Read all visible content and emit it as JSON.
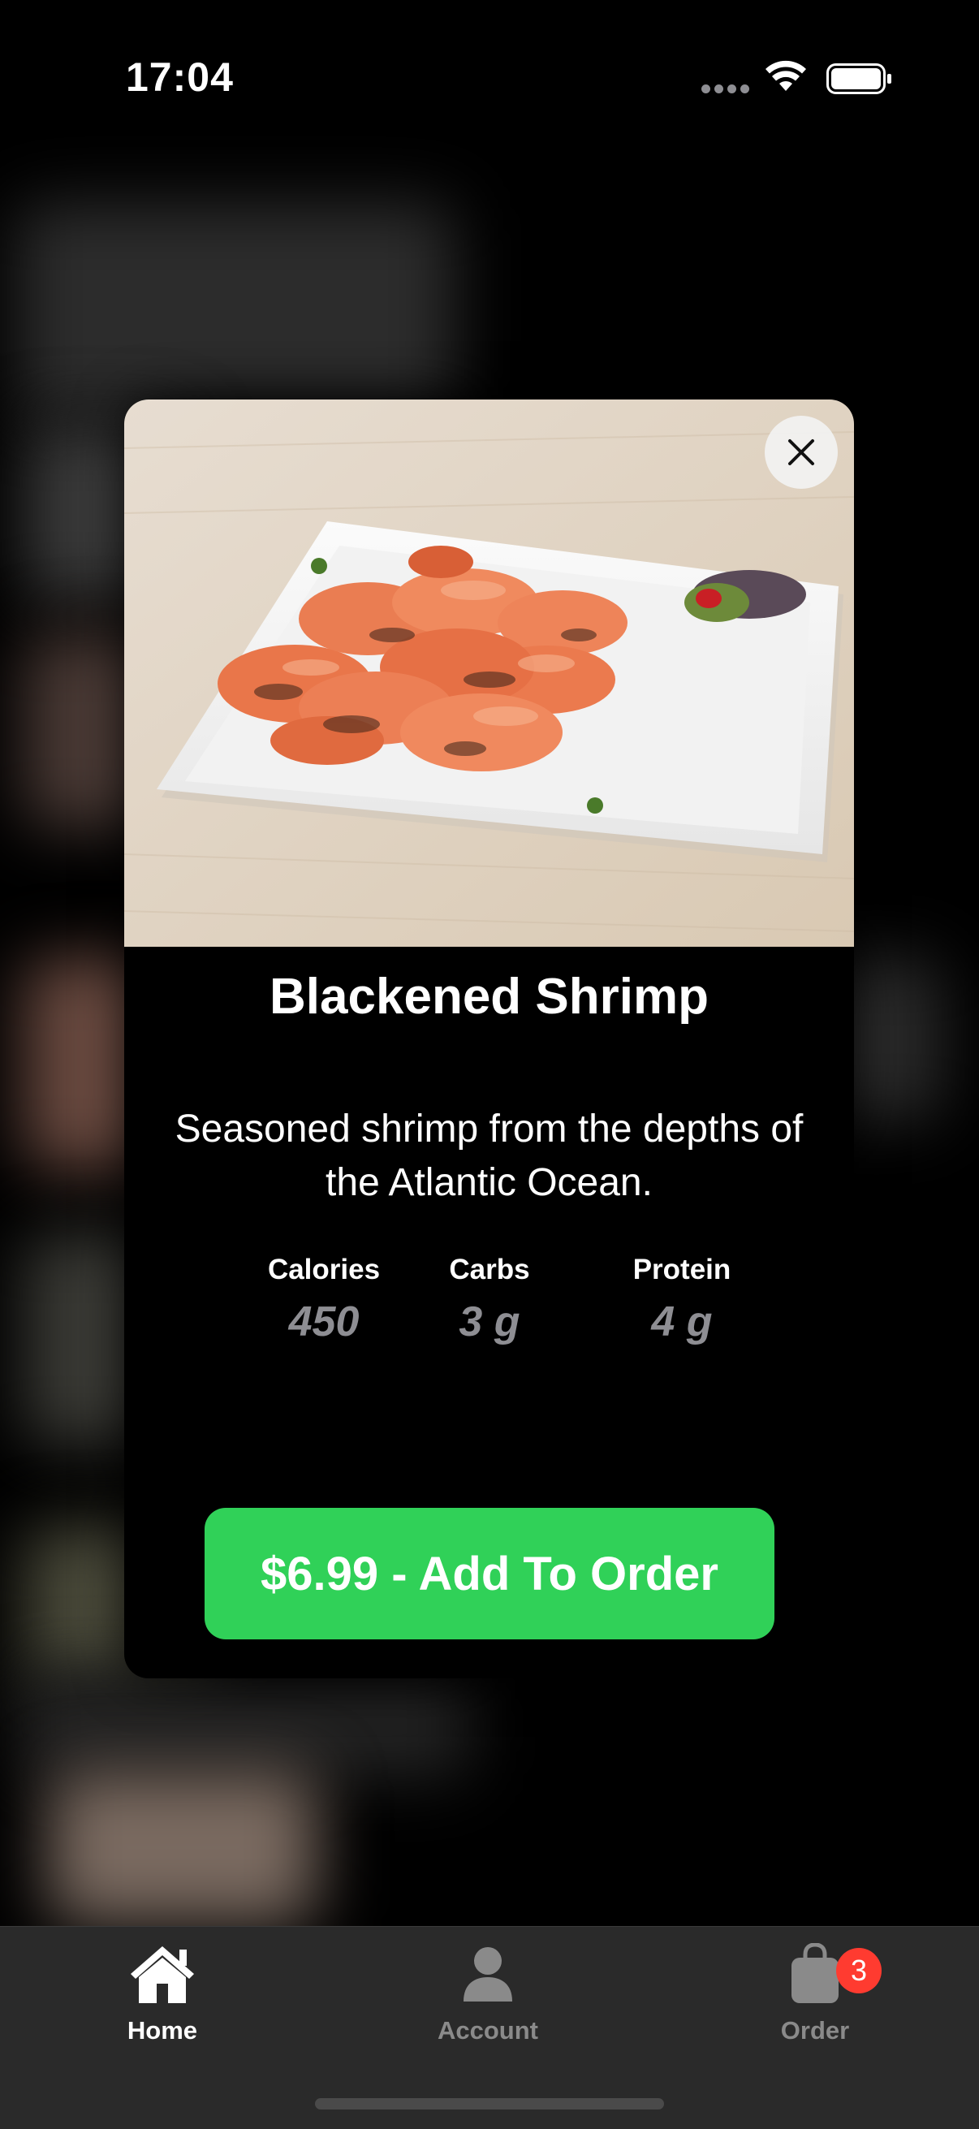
{
  "status_bar": {
    "time": "17:04"
  },
  "item": {
    "title": "Blackened Shrimp",
    "description": "Seasoned shrimp from the depths of the Atlantic Ocean.",
    "nutrition": [
      {
        "label": "Calories",
        "value": "450"
      },
      {
        "label": "Carbs",
        "value": "3 g"
      },
      {
        "label": "Protein",
        "value": "4 g"
      }
    ],
    "add_button_label": "$6.99 - Add To Order"
  },
  "tab_bar": {
    "tabs": [
      {
        "label": "Home",
        "icon": "house-icon",
        "active": true
      },
      {
        "label": "Account",
        "icon": "person-icon",
        "active": false
      },
      {
        "label": "Order",
        "icon": "bag-icon",
        "active": false,
        "badge": "3"
      }
    ]
  },
  "colors": {
    "accent_green": "#30d158",
    "badge_red": "#ff3b30",
    "tab_bar_bg": "#2a2a2a",
    "secondary_text": "#8e8e93"
  }
}
